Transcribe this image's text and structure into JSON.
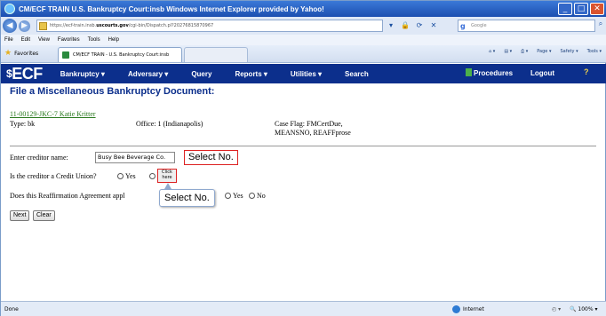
{
  "browser": {
    "title": "CM/ECF TRAIN   U.S. Bankruptcy Court:insb   Windows Internet Explorer provided by Yahoo!",
    "address_prefix": "https://ecf-train.insb.",
    "address_host": "uscourts.gov",
    "address_path": "/cgi-bin/Dispatch.pl?20276815870967",
    "search_placeholder": "Google",
    "menu": [
      "File",
      "Edit",
      "View",
      "Favorites",
      "Tools",
      "Help"
    ],
    "favorites_label": "Favorites",
    "tab_title": "CM/ECF TRAIN - U.S. Bankruptcy Court:insb",
    "commands": [
      "Page ▾",
      "Safety ▾",
      "Tools ▾"
    ],
    "window_buttons": [
      "_",
      "□",
      "✕"
    ]
  },
  "ecf_nav": {
    "logo": "ECF",
    "items": [
      "Bankruptcy ▾",
      "Adversary ▾",
      "Query",
      "Reports ▾",
      "Utilities ▾",
      "Search"
    ],
    "procedures": "Procedures",
    "logout": "Logout",
    "help": "?"
  },
  "page": {
    "title": "File a Miscellaneous Bankruptcy Document:",
    "case_link": "11-00129-JKC-7 Katie Kritter",
    "type": "Type: bk",
    "office": "Office: 1 (Indianapolis)",
    "case_flag_line1": "Case Flag: FMCertDue,",
    "case_flag_line2": "MEANSNO, REAFFprose"
  },
  "form": {
    "creditor_label": "Enter creditor name:",
    "creditor_value": "Busy Bee Beverage Co.",
    "callout_select": "Select No.",
    "credit_union_question": "Is the creditor a Credit Union?",
    "yes": "Yes",
    "no": "No",
    "hot_text": "Click here",
    "tooltip": "Select No.",
    "reaffirm_question": "Does this Reaffirmation Agreement appl",
    "next": "Next",
    "clear": "Clear"
  },
  "statusbar": {
    "done": "Done",
    "zone": "Internet",
    "zoom": "100%"
  }
}
